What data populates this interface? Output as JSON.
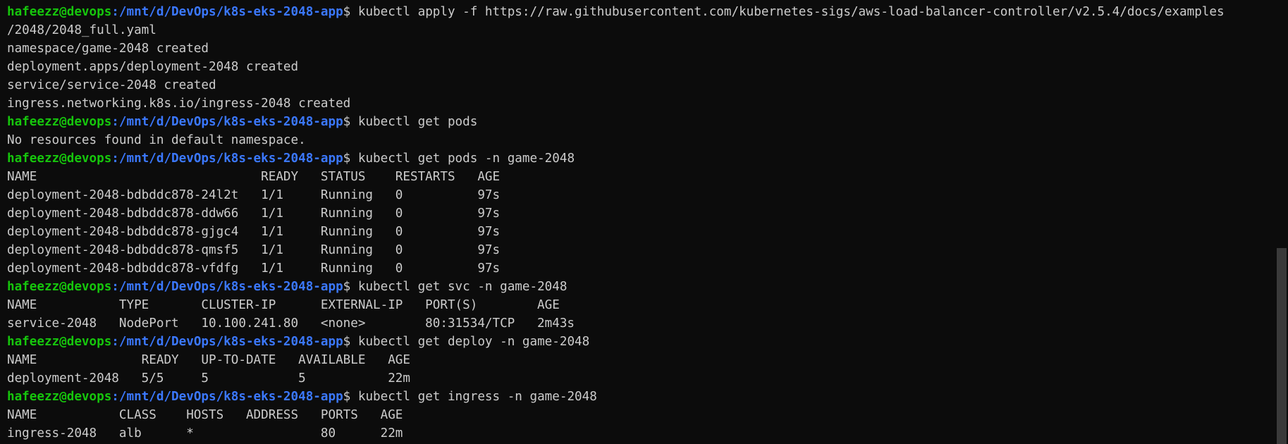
{
  "prompt": {
    "user": "hafeezz@devops",
    "path": ":/mnt/d/DevOps/k8s-eks-2048-app"
  },
  "lines": [
    {
      "type": "prompt",
      "cmd": "$ kubectl apply -f https://raw.githubusercontent.com/kubernetes-sigs/aws-load-balancer-controller/v2.5.4/docs/examples"
    },
    {
      "type": "out",
      "text": "/2048/2048_full.yaml"
    },
    {
      "type": "out",
      "text": "namespace/game-2048 created"
    },
    {
      "type": "out",
      "text": "deployment.apps/deployment-2048 created"
    },
    {
      "type": "out",
      "text": "service/service-2048 created"
    },
    {
      "type": "out",
      "text": "ingress.networking.k8s.io/ingress-2048 created"
    },
    {
      "type": "prompt",
      "cmd": "$ kubectl get pods"
    },
    {
      "type": "out",
      "text": "No resources found in default namespace."
    },
    {
      "type": "prompt",
      "cmd": "$ kubectl get pods -n game-2048"
    },
    {
      "type": "out",
      "text": "NAME                              READY   STATUS    RESTARTS   AGE"
    },
    {
      "type": "out",
      "text": "deployment-2048-bdbddc878-24l2t   1/1     Running   0          97s"
    },
    {
      "type": "out",
      "text": "deployment-2048-bdbddc878-ddw66   1/1     Running   0          97s"
    },
    {
      "type": "out",
      "text": "deployment-2048-bdbddc878-gjgc4   1/1     Running   0          97s"
    },
    {
      "type": "out",
      "text": "deployment-2048-bdbddc878-qmsf5   1/1     Running   0          97s"
    },
    {
      "type": "out",
      "text": "deployment-2048-bdbddc878-vfdfg   1/1     Running   0          97s"
    },
    {
      "type": "prompt",
      "cmd": "$ kubectl get svc -n game-2048"
    },
    {
      "type": "out",
      "text": "NAME           TYPE       CLUSTER-IP      EXTERNAL-IP   PORT(S)        AGE"
    },
    {
      "type": "out",
      "text": "service-2048   NodePort   10.100.241.80   <none>        80:31534/TCP   2m43s"
    },
    {
      "type": "prompt",
      "cmd": "$ kubectl get deploy -n game-2048"
    },
    {
      "type": "out",
      "text": "NAME              READY   UP-TO-DATE   AVAILABLE   AGE"
    },
    {
      "type": "out",
      "text": "deployment-2048   5/5     5            5           22m"
    },
    {
      "type": "prompt",
      "cmd": "$ kubectl get ingress -n game-2048"
    },
    {
      "type": "out",
      "text": "NAME           CLASS    HOSTS   ADDRESS   PORTS   AGE"
    },
    {
      "type": "out",
      "text": "ingress-2048   alb      *                 80      22m"
    }
  ],
  "colors": {
    "background": "#0c0c0c",
    "prompt_user": "#16c60c",
    "prompt_path": "#3b78ff",
    "text": "#cccccc"
  }
}
